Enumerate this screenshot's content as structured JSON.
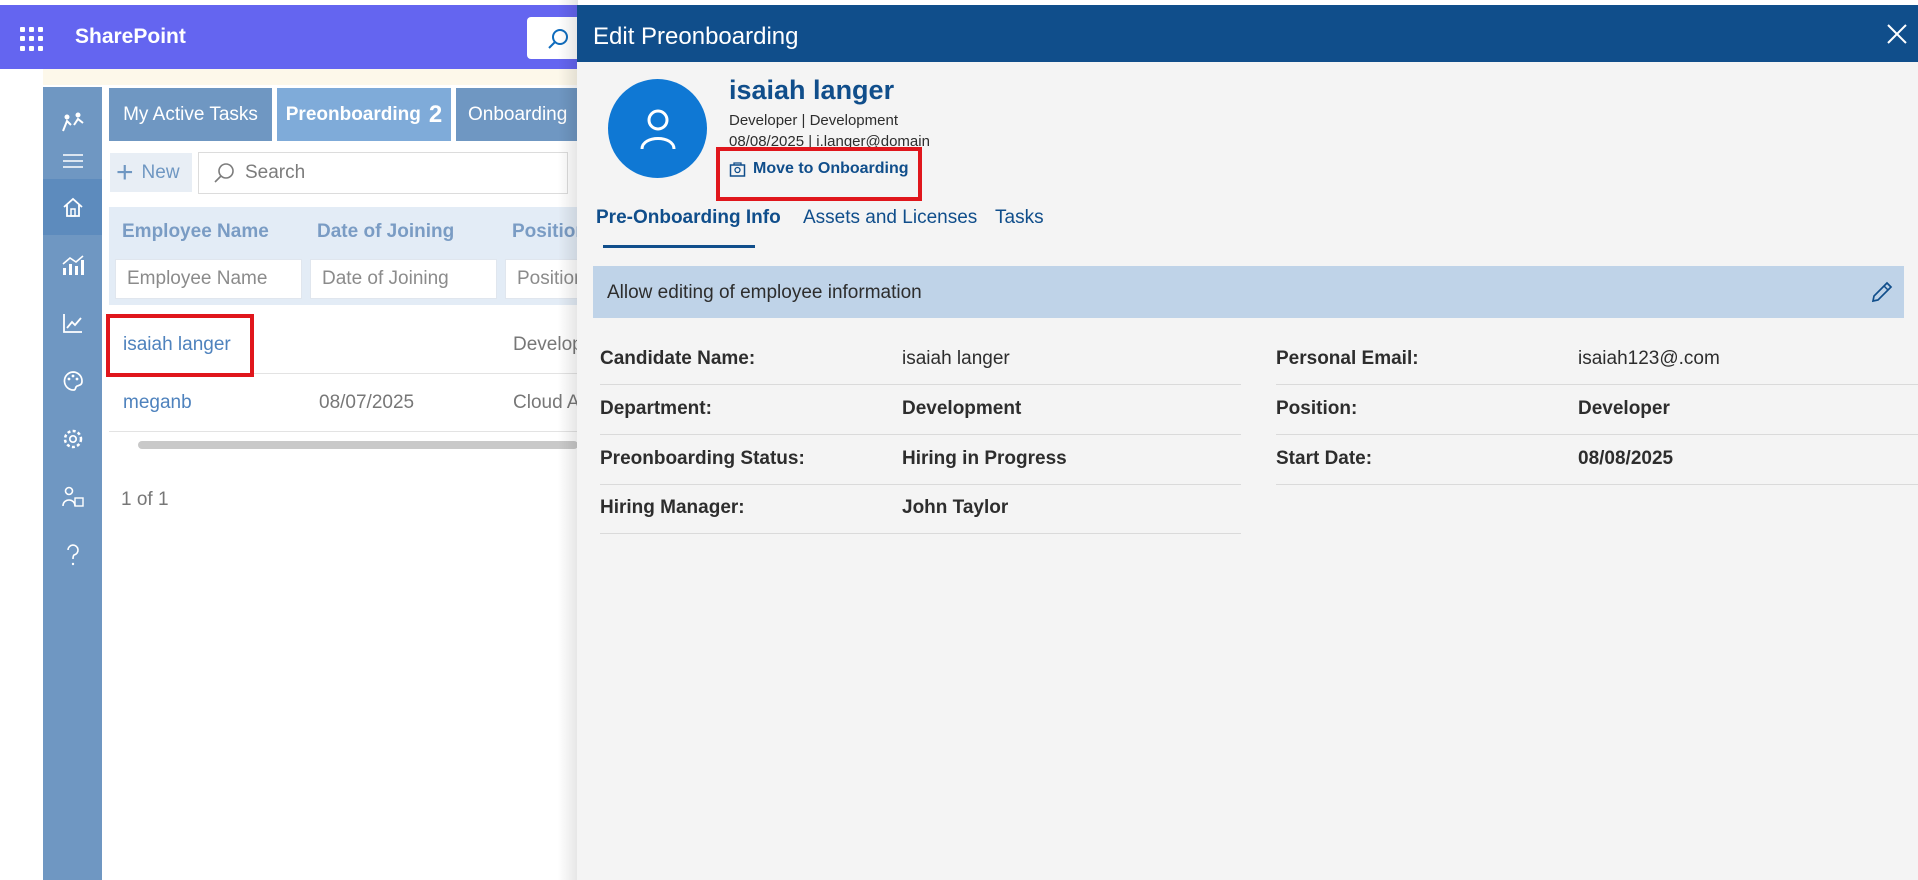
{
  "suitebar": {
    "brand": "SharePoint"
  },
  "tabs": [
    {
      "label": "My Active Tasks"
    },
    {
      "label": "Preonboarding",
      "count": "2"
    },
    {
      "label": "Onboarding"
    }
  ],
  "toolbar": {
    "new_label": "New",
    "search_placeholder": "Search"
  },
  "grid": {
    "columns": [
      "Employee Name",
      "Date of Joining",
      "Position"
    ],
    "filters": [
      "Employee Name",
      "Date of Joining",
      "Position"
    ],
    "rows": [
      {
        "name": "isaiah langer",
        "date": "",
        "position": "Develop"
      },
      {
        "name": "meganb",
        "date": "08/07/2025",
        "position": "Cloud A"
      }
    ],
    "pager": "1 of 1"
  },
  "panel": {
    "title": "Edit Preonboarding",
    "user": {
      "name": "isaiah langer",
      "role_line": "Developer | Development",
      "date_email_line": "08/08/2025 | i.langer@domain"
    },
    "move_button": "Move to Onboarding",
    "tabs": [
      "Pre-Onboarding Info",
      "Assets and Licenses",
      "Tasks"
    ],
    "edit_bar": "Allow editing of employee information",
    "fields_left": [
      {
        "label": "Candidate Name:",
        "value": "isaiah langer"
      },
      {
        "label": "Department:",
        "value": "Development"
      },
      {
        "label": "Preonboarding Status:",
        "value": "Hiring in Progress"
      },
      {
        "label": "Hiring Manager:",
        "value": "John Taylor"
      }
    ],
    "fields_right": [
      {
        "label": "Personal Email:",
        "value": "isaiah123@.com"
      },
      {
        "label": "Position:",
        "value": "Developer"
      },
      {
        "label": "Start Date:",
        "value": "08/08/2025"
      }
    ]
  },
  "colors": {
    "suitebar": "#6465f0",
    "panel_header": "#104e8b",
    "nav": "#6f97c2",
    "highlight": "#e0161c"
  },
  "icons": [
    "waffle-icon",
    "search-icon",
    "people-icon",
    "menu-icon",
    "home-icon",
    "analytics-icon",
    "trend-icon",
    "palette-icon",
    "settings-icon",
    "user-group-icon",
    "help-icon",
    "close-icon",
    "person-icon",
    "move-icon",
    "edit-icon"
  ]
}
